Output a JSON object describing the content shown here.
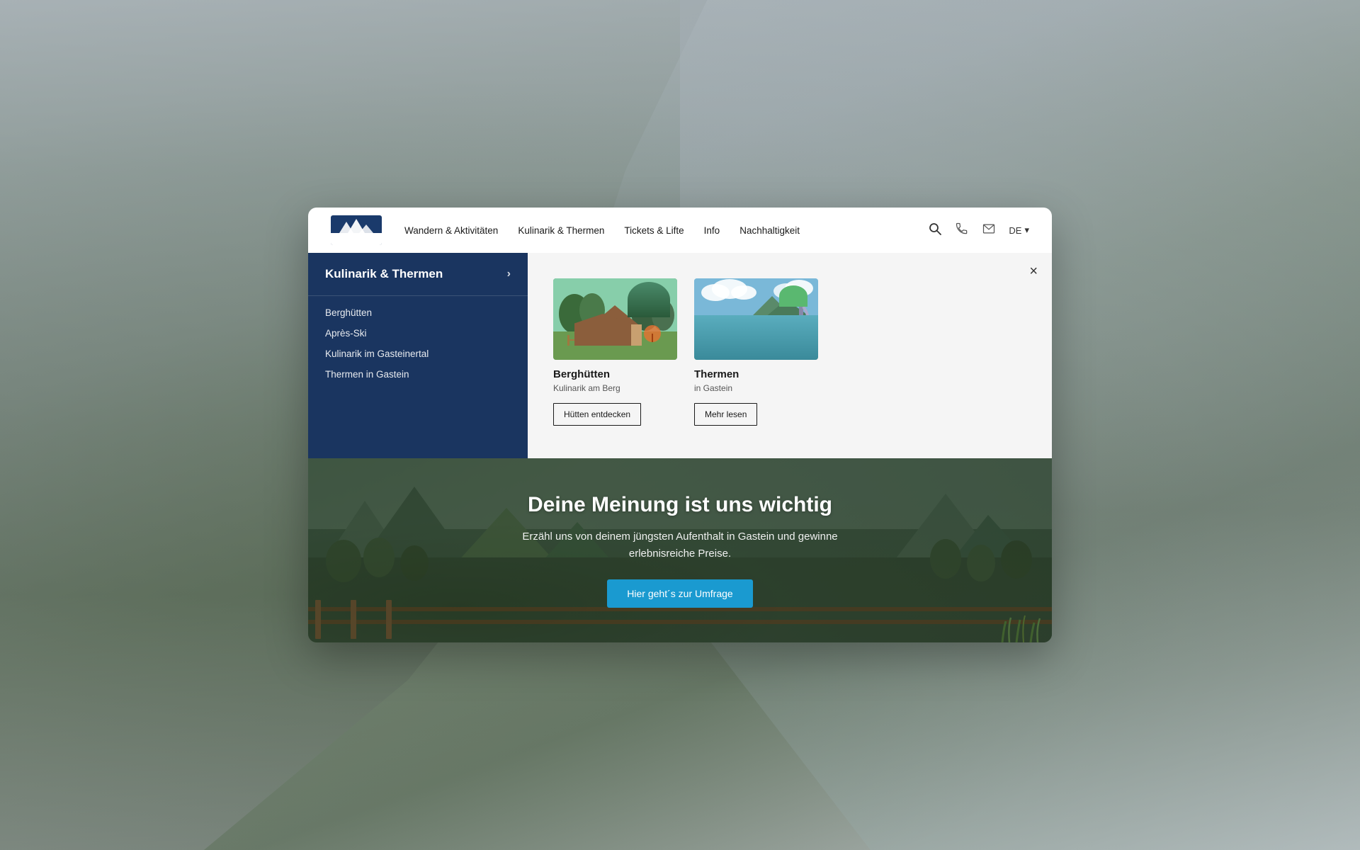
{
  "background": {
    "color": "#c8cdd4"
  },
  "navbar": {
    "logo_alt": "Gasteiner Bergbahnen",
    "links": [
      {
        "id": "wandern",
        "label": "Wandern & Aktivitäten"
      },
      {
        "id": "kulinarik",
        "label": "Kulinarik & Thermen"
      },
      {
        "id": "tickets",
        "label": "Tickets & Lifte"
      },
      {
        "id": "info",
        "label": "Info"
      },
      {
        "id": "nachhaltigkeit",
        "label": "Nachhaltigkeit"
      }
    ],
    "search_icon": "🔍",
    "phone_icon": "📞",
    "email_icon": "✉",
    "lang": "DE",
    "lang_chevron": "▾"
  },
  "dropdown": {
    "sidebar_title": "Kulinarik & Thermen",
    "menu_items": [
      {
        "id": "bergh",
        "label": "Berghütten"
      },
      {
        "id": "apres",
        "label": "Après-Ski"
      },
      {
        "id": "kulin",
        "label": "Kulinarik im Gasteinertal"
      },
      {
        "id": "therm",
        "label": "Thermen in Gastein"
      }
    ],
    "close_label": "×",
    "cards": [
      {
        "id": "berghütten",
        "title": "Berghütten",
        "subtitle": "Kulinarik am Berg",
        "button_label": "Hütten entdecken"
      },
      {
        "id": "thermen",
        "title": "Thermen",
        "subtitle": "in Gastein",
        "button_label": "Mehr lesen"
      }
    ]
  },
  "hero": {
    "title": "Deine Meinung ist uns wichtig",
    "subtitle_line1": "Erzähl uns von deinem jüngsten Aufenthalt in Gastein und gewinne",
    "subtitle_line2": "erlebnisreiche Preise.",
    "button_label": "Hier geht´s zur Umfrage"
  }
}
